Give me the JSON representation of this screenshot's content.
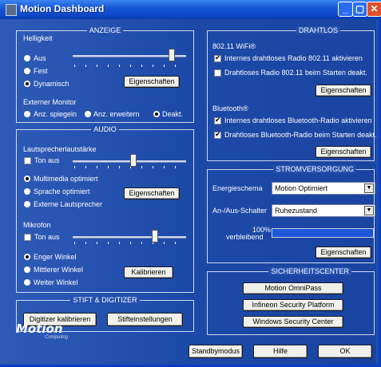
{
  "window": {
    "title": "Motion Dashboard",
    "min_glyph": "_",
    "max_glyph": "▢",
    "close_glyph": "✕"
  },
  "anzeige": {
    "legend": "ANZEIGE",
    "helligkeit_label": "Helligkeit",
    "brightness_options": [
      "Aus",
      "Fest",
      "Dynamisch"
    ],
    "brightness_selected": "Dynamisch",
    "brightness_level": 0.87,
    "eigenschaften": "Eigenschaften",
    "monitor_label": "Externer Monitor",
    "monitor_options": [
      "Anz. spiegeln",
      "Anz. erweitern",
      "Deakt."
    ],
    "monitor_selected": "Deakt."
  },
  "audio": {
    "legend": "AUDIO",
    "lautsprecher_label": "Lautsprecherlautstärke",
    "ton_aus": "Ton aus",
    "speaker_level": 0.52,
    "speaker_options": [
      "Multimedia optimiert",
      "Sprache optimiert",
      "Externe Lautsprecher"
    ],
    "speaker_selected": "Multimedia optimiert",
    "eigenschaften": "Eigenschaften",
    "mikrofon_label": "Mikrofon",
    "mic_ton_aus": "Ton aus",
    "mic_level": 0.72,
    "mic_options": [
      "Enger Winkel",
      "Mittlerer Winkel",
      "Weiter Winkel"
    ],
    "mic_selected": "Enger Winkel",
    "kalibrieren": "Kalibrieren"
  },
  "stift": {
    "legend": "STIFT & DIGITIZER",
    "digitizer_btn": "Digitizer kalibrieren",
    "stift_btn": "Stifteinstellungen"
  },
  "drahtlos": {
    "legend": "DRAHTLOS",
    "wifi_label": "802.11 WiFi®",
    "wifi_opt1": "Internes drahtloses Radio 802.11 aktivieren",
    "wifi_opt1_checked": true,
    "wifi_opt2": "Drahtloses Radio 802.11 beim Starten deakt.",
    "wifi_opt2_checked": false,
    "eigenschaften": "Eigenschaften",
    "bt_label": "Bluetooth®",
    "bt_opt1": "Internes drahtloses Bluetooth-Radio aktivieren",
    "bt_opt1_checked": true,
    "bt_opt2": "Drahtloses Bluetooth-Radio beim Starten deakt.",
    "bt_opt2_checked": true,
    "bt_eigenschaften": "Eigenschaften"
  },
  "strom": {
    "legend": "STROMVERSORGUNG",
    "schema_label": "Energieschema",
    "schema_value": "Motion Optimiert",
    "schalter_label": "An-/Aus-Schalter",
    "schalter_value": "Ruhezustand",
    "percent": "100%",
    "verbleibend": "verbleibend",
    "battery_level": 1.0,
    "eigenschaften": "Eigenschaften"
  },
  "sicherheit": {
    "legend": "SICHERHEITSCENTER",
    "buttons": [
      "Motion OmniPass",
      "Infineon Security Platform",
      "Windows Security Center"
    ]
  },
  "footer": {
    "logo": "Motion",
    "logo_sub": "Computing",
    "standby": "Standbymodus",
    "hilfe": "Hilfe",
    "ok": "OK"
  }
}
